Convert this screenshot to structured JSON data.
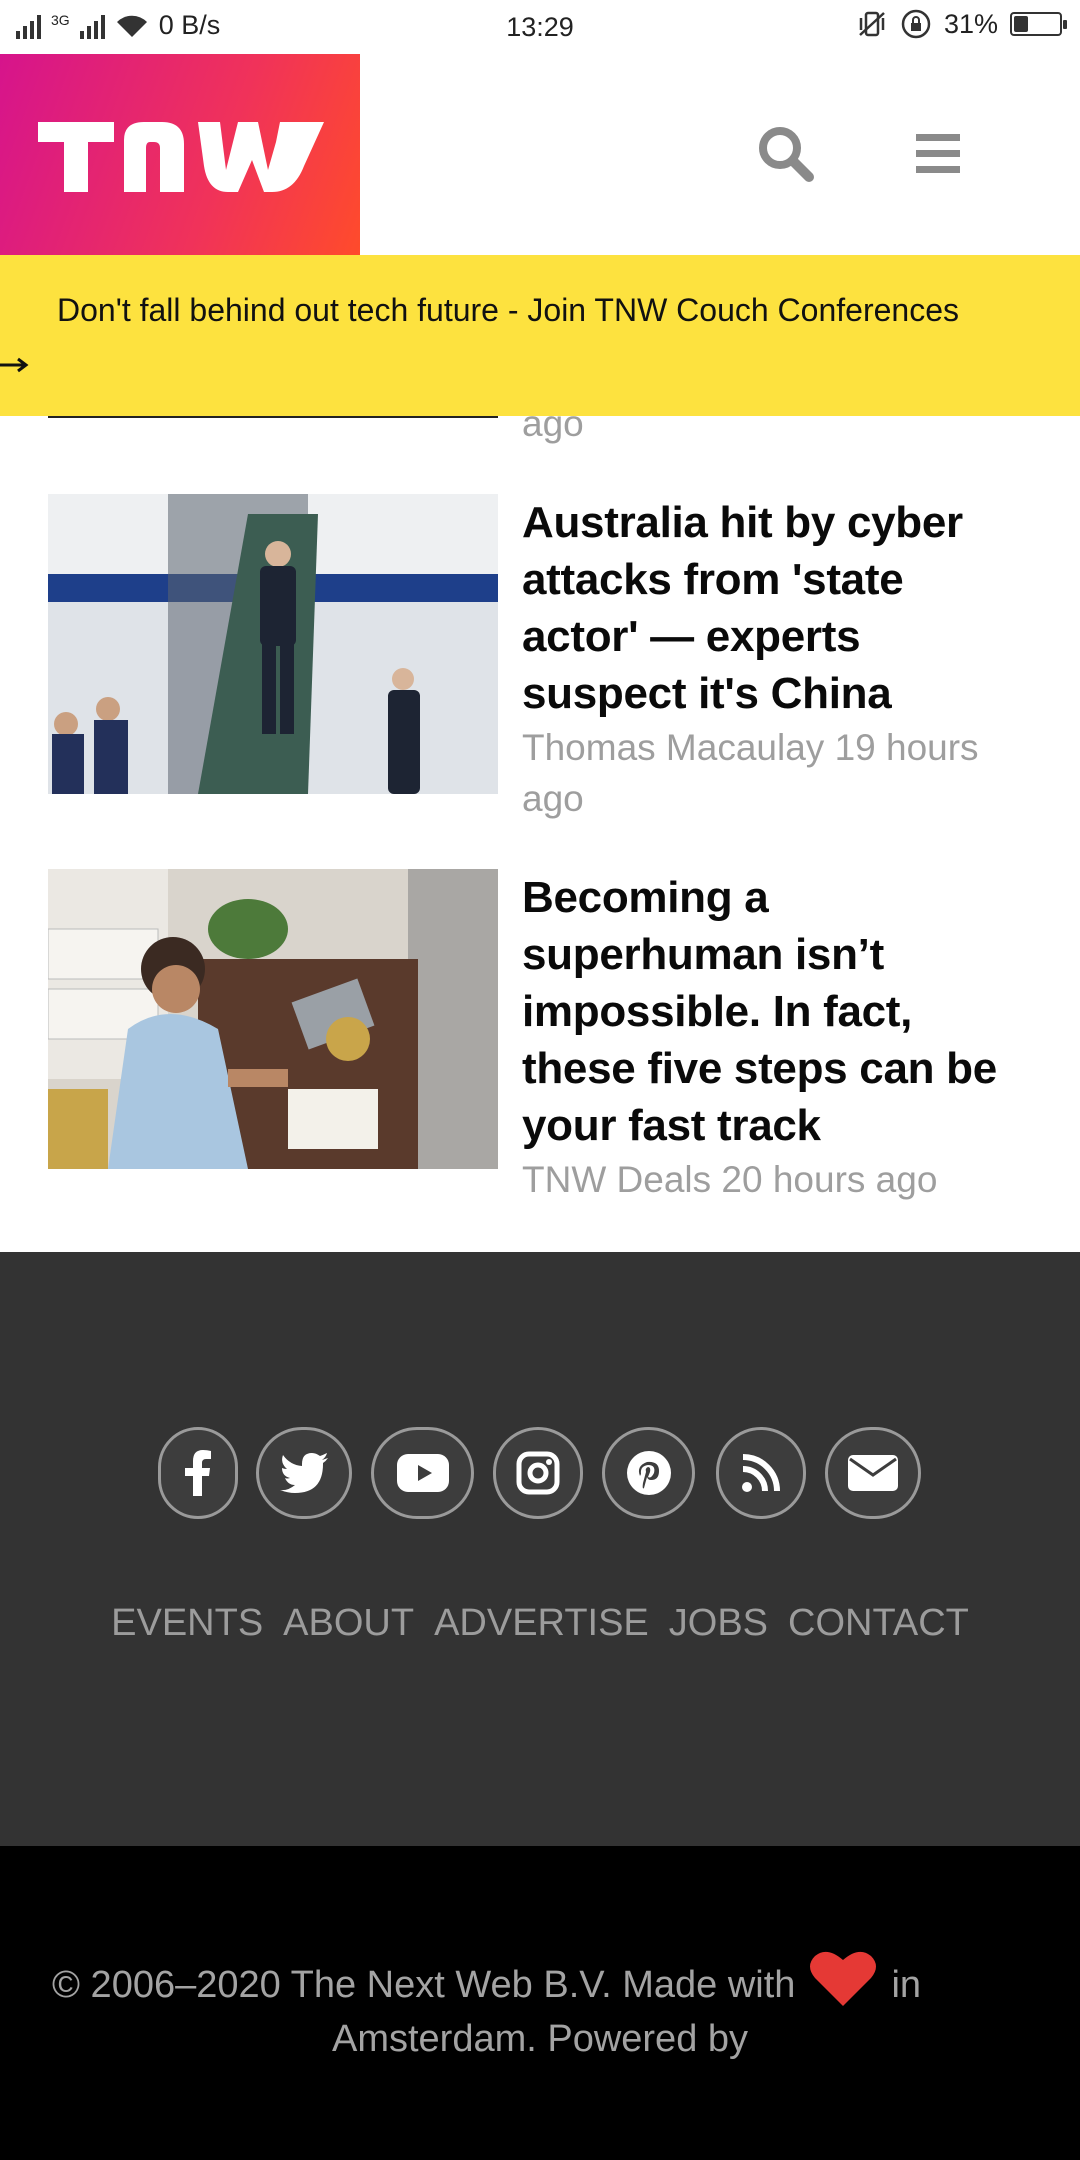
{
  "status_bar": {
    "network_label": "3G",
    "speed": "0 B/s",
    "time": "13:29",
    "battery": "31%",
    "battery_level": 0.31
  },
  "header": {
    "logo_text": "TNW",
    "search_icon": "search-icon",
    "menu_icon": "hamburger-menu-icon"
  },
  "banner": {
    "text": "Don't fall behind out tech future - Join TNW Couch Conferences"
  },
  "partial_article": {
    "meta_tail": "ago"
  },
  "articles": [
    {
      "title_lines": [
        "Australia hit by cyber",
        "attacks from 'state",
        "actor' — experts",
        "suspect it's China"
      ],
      "meta_line1": "Thomas Macaulay 19 hours",
      "meta_line2": "ago"
    },
    {
      "title_lines": [
        "Becoming a",
        "superhuman isn’t",
        "impossible. In fact,",
        "these five steps can be",
        "your fast track"
      ],
      "meta_line1": "TNW Deals 20 hours ago"
    }
  ],
  "footer": {
    "social_icons": [
      "facebook-icon",
      "twitter-icon",
      "youtube-icon",
      "instagram-icon",
      "pinterest-icon",
      "rss-icon",
      "email-icon"
    ],
    "links": [
      "EVENTS",
      "ABOUT",
      "ADVERTISE",
      "JOBS",
      "CONTACT"
    ],
    "copyright_line1_before": "© 2006–2020 The Next Web B.V. Made with",
    "copyright_line1_after": "in",
    "copyright_line2": "Amsterdam. Powered by",
    "colors": {
      "footer_bg": "#333333",
      "copyright_bg": "#000000",
      "heart": "#e53935",
      "banner": "#fde23f"
    }
  }
}
